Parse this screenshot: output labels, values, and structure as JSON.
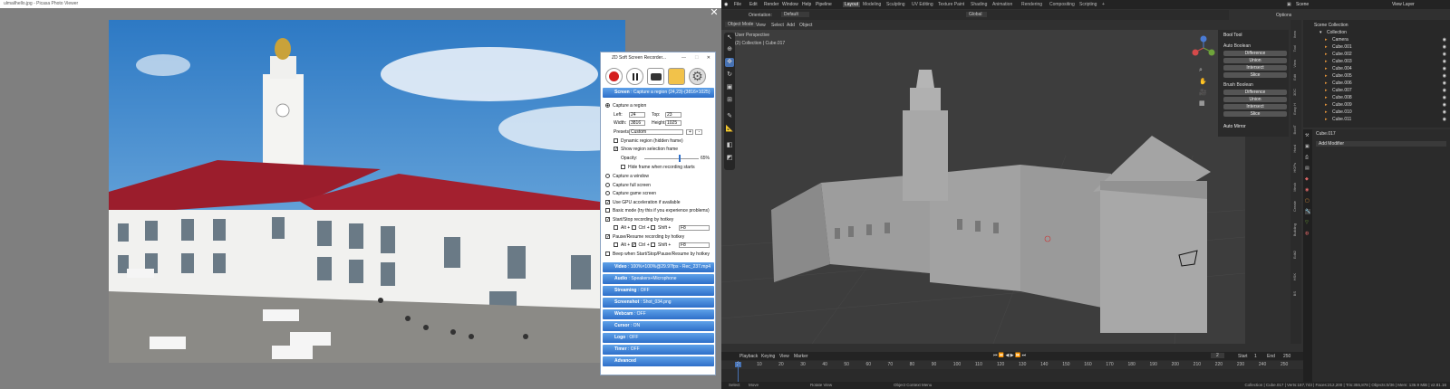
{
  "picasa": {
    "window_title": "ulmailhello.jpg - Picasa Photo Viewer"
  },
  "recorder": {
    "title": "ZD Soft Screen Recorder...",
    "screen_header_label": "Screen",
    "screen_header_value": " : Capture a region (24,23)-(3816×1025)",
    "capture_region": "Capture a region",
    "left_label": "Left:",
    "left_value": "24",
    "top_label": "Top:",
    "top_value": "23",
    "width_label": "Width:",
    "width_value": "3816",
    "height_label": "Height:",
    "height_value": "1025",
    "presets_label": "Presets:",
    "presets_value": "Custom",
    "dynamic_region": "Dynamic region (hidden frame)",
    "show_selection": "Show region selection frame",
    "opacity_label": "Opacity:",
    "opacity_value": "65%",
    "hide_frame": "Hide frame when recording starts",
    "capture_window": "Capture a window",
    "capture_full": "Capture full screen",
    "capture_game": "Capture game screen",
    "use_gpu": "Use GPU acceleration if available",
    "basic_mode": "Basic mode (try this if you experience problems)",
    "start_stop_hotkey": "Start/Stop recording by hotkey",
    "pause_resume_hotkey": "Pause/Resume recording by hotkey",
    "alt": "Alt +",
    "ctrl": "Ctrl +",
    "shift": "Shift +",
    "key1": "F8",
    "key2": "F8",
    "beep": "Beep when Start/Stop/Pause/Resume by hotkey",
    "sections": [
      {
        "label": "Video",
        "value": " : 100%×100%@29.97fps - Rec_237.mp4"
      },
      {
        "label": "Audio",
        "value": " : Speakers+Microphone"
      },
      {
        "label": "Streaming",
        "value": " : OFF"
      },
      {
        "label": "Screenshot",
        "value": " : Shot_034.png"
      },
      {
        "label": "Webcam",
        "value": " : OFF"
      },
      {
        "label": "Cursor",
        "value": " : ON"
      },
      {
        "label": "Logo",
        "value": " : OFF"
      },
      {
        "label": "Timer",
        "value": " : OFF"
      },
      {
        "label": "Advanced",
        "value": ""
      }
    ]
  },
  "blender": {
    "menu": [
      "File",
      "Edit",
      "Render",
      "Window",
      "Help",
      "Pipeline"
    ],
    "workspaces": [
      "Layout",
      "Modeling",
      "Sculpting",
      "UV Editing",
      "Texture Paint",
      "Shading",
      "Animation",
      "Rendering",
      "Compositing",
      "Scripting"
    ],
    "active_workspace": "Layout",
    "scene_name": "Scene",
    "view_layer": "View Layer",
    "orientation_label": "Orientation:",
    "orientation_value": "Default",
    "transform_global": "Global",
    "options_label": "Options",
    "mode": "Object Mode",
    "header_menu": [
      "View",
      "Select",
      "Add",
      "Object"
    ],
    "perspective": "User Perspective",
    "collection_info": "(2) Collection | Cube.017",
    "npanel": {
      "bool_tool": "Bool Tool",
      "auto_boolean": "Auto Boolean",
      "brush_boolean": "Brush Boolean",
      "buttons": [
        "Difference",
        "Union",
        "Intersect",
        "Slice"
      ],
      "auto_mirror": "Auto Mirror"
    },
    "ntabs": [
      "Item",
      "Tool",
      "View",
      "Edit",
      "3DC",
      "Easy H",
      "BoolT",
      "Hard",
      "HOPs",
      "Mesh",
      "Create",
      "Building",
      "Edit2",
      "HSK",
      "BS"
    ],
    "outliner": {
      "scene_collection": "Scene Collection",
      "collection": "Collection",
      "items": [
        "Camera",
        "Cube.001",
        "Cube.002",
        "Cube.003",
        "Cube.004",
        "Cube.005",
        "Cube.006",
        "Cube.007",
        "Cube.008",
        "Cube.009",
        "Cube.010",
        "Cube.011"
      ]
    },
    "properties": {
      "object_name": "Cube.017",
      "add_modifier": "Add Modifier"
    },
    "timeline": {
      "menu": [
        "Playback",
        "Keying",
        "View",
        "Marker"
      ],
      "current_frame": "2",
      "start_label": "Start",
      "start_value": "1",
      "end_label": "End",
      "end_value": "250",
      "ticks": [
        "2",
        "10",
        "20",
        "30",
        "40",
        "50",
        "60",
        "70",
        "80",
        "90",
        "100",
        "110",
        "120",
        "130",
        "140",
        "150",
        "160",
        "170",
        "180",
        "190",
        "200",
        "210",
        "220",
        "230",
        "240",
        "250"
      ]
    },
    "statusbar": {
      "select": "Select",
      "move": "Move",
      "rotate": "Rotate View",
      "context": "Object Context Menu",
      "stats": "Collection | Cube.017 | Verts:187,743 | Faces:212,200 | Tris:355,878 | Objects:0/36 | Mem: 136.9 MiB | v2.81.16"
    }
  }
}
